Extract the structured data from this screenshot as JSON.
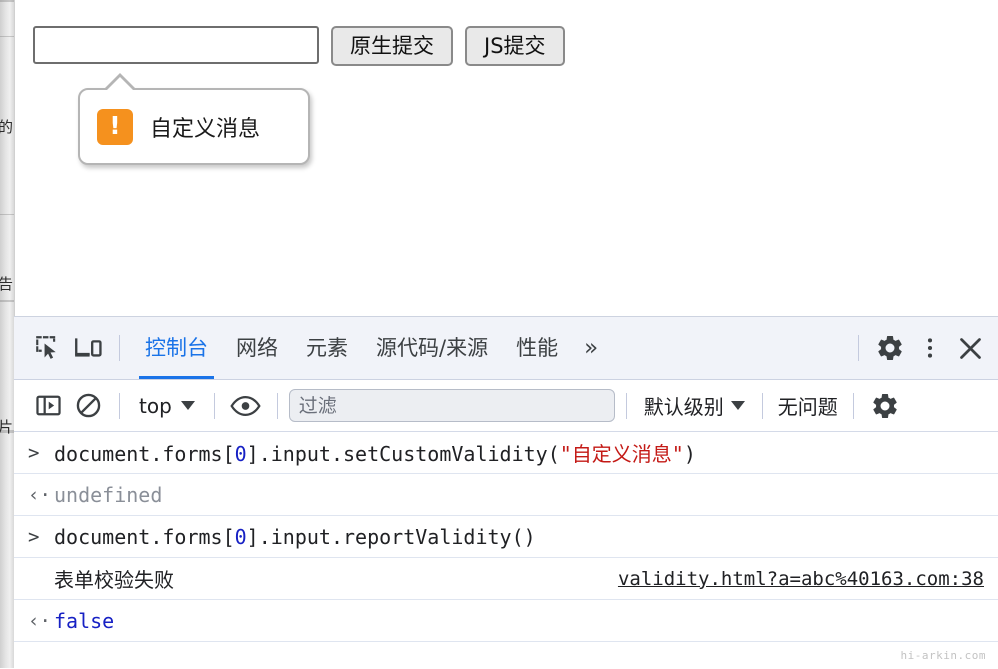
{
  "page": {
    "input_value": "",
    "input_placeholder": "",
    "buttons": [
      {
        "label": "原生提交",
        "name": "native-submit-button"
      },
      {
        "label": "JS提交",
        "name": "js-submit-button"
      }
    ],
    "validation_bubble": {
      "message": "自定义消息",
      "icon": "warning-exclamation-icon",
      "icon_glyph": "!",
      "icon_color": "#f5911e"
    },
    "background_sliver_glyphs": [
      "的",
      "告",
      "片"
    ]
  },
  "devtools": {
    "tabstrip": {
      "icons": [
        {
          "name": "inspect-element-icon"
        },
        {
          "name": "device-toolbar-icon"
        }
      ],
      "tabs": [
        {
          "label": "控制台",
          "active": true
        },
        {
          "label": "网络",
          "active": false
        },
        {
          "label": "元素",
          "active": false
        },
        {
          "label": "源代码/来源",
          "active": false
        },
        {
          "label": "性能",
          "active": false
        }
      ],
      "overflow_label": "»",
      "right_icons": [
        {
          "name": "settings-gear-icon"
        },
        {
          "name": "more-options-icon"
        },
        {
          "name": "close-devtools-icon"
        }
      ],
      "active_tab_color": "#1a73e8"
    },
    "filterbar": {
      "sidebar_toggle": "console-sidebar-toggle-icon",
      "clear_console": "clear-console-icon",
      "context_label": "top",
      "eye_icon": "live-expression-eye-icon",
      "filter_placeholder": "过滤",
      "filter_value": "",
      "level_label": "默认级别",
      "issues_label": "无问题",
      "settings_icon": "console-settings-gear-icon"
    },
    "console_rows": [
      {
        "type": "input",
        "marker": ">",
        "prefix": "document.forms[",
        "number": "0",
        "middle": "].input.setCustomValidity(",
        "quote_open": "\"",
        "string": "自定义消息",
        "quote_close": "\"",
        "suffix": ")"
      },
      {
        "type": "output-undefined",
        "marker": "‹·",
        "text": "undefined"
      },
      {
        "type": "input",
        "marker": ">",
        "prefix": "document.forms[",
        "number": "0",
        "middle": "].input.reportValidity()",
        "quote_open": "",
        "string": "",
        "quote_close": "",
        "suffix": ""
      },
      {
        "type": "log",
        "text": "表单校验失败",
        "source": "validity.html?a=abc%40163.com:38"
      },
      {
        "type": "output-false",
        "marker": "‹·",
        "text": "false"
      }
    ]
  },
  "watermark": "hi-arkin.com"
}
